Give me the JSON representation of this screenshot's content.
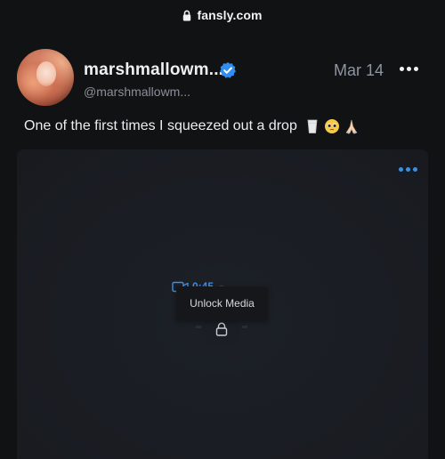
{
  "browser": {
    "url": "fansly.com"
  },
  "post": {
    "display_name": "marshmallowm...",
    "handle": "@marshmallowm...",
    "date": "Mar 14",
    "caption": "One of the first times I squeezed out a drop",
    "caption_emojis": [
      "milk-glass",
      "pleading-face",
      "folded-hands"
    ]
  },
  "media": {
    "duration": "0:45",
    "unlock_label": "Unlock Media"
  },
  "colors": {
    "background": "#111213",
    "card": "#1a1d23",
    "accent_blue": "#3d8fe0",
    "verified_blue": "#2f8ef0",
    "muted_text": "#8b8f98"
  },
  "icons": {
    "url_lock": "lock-icon",
    "verified": "verified-badge-icon",
    "header_more": "more-horizontal-icon",
    "media_more": "more-horizontal-icon",
    "video": "video-camera-icon",
    "unlock": "lock-icon"
  }
}
